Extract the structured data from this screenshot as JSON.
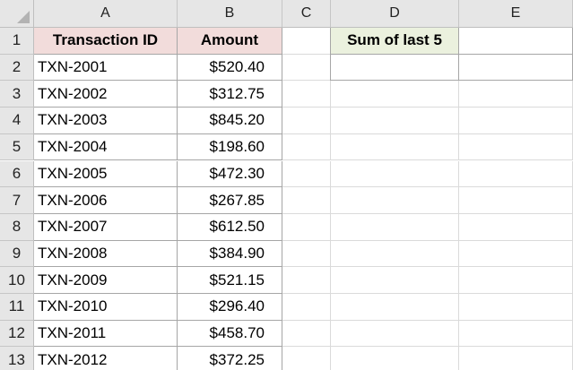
{
  "sheet": {
    "columns": [
      "A",
      "B",
      "C",
      "D",
      "E"
    ],
    "rows": [
      "1",
      "2",
      "3",
      "4",
      "5",
      "6",
      "7",
      "8",
      "9",
      "10",
      "11",
      "12",
      "13"
    ],
    "header": {
      "col_a": "Transaction ID",
      "col_b": "Amount",
      "col_d": "Sum of last 5",
      "col_e": ""
    },
    "records": [
      {
        "id": "TXN-2001",
        "amount": "$520.40"
      },
      {
        "id": "TXN-2002",
        "amount": "$312.75"
      },
      {
        "id": "TXN-2003",
        "amount": "$845.20"
      },
      {
        "id": "TXN-2004",
        "amount": "$198.60"
      },
      {
        "id": "TXN-2005",
        "amount": "$472.30"
      },
      {
        "id": "TXN-2006",
        "amount": "$267.85"
      },
      {
        "id": "TXN-2007",
        "amount": "$612.50"
      },
      {
        "id": "TXN-2008",
        "amount": "$384.90"
      },
      {
        "id": "TXN-2009",
        "amount": "$521.15"
      },
      {
        "id": "TXN-2010",
        "amount": "$296.40"
      },
      {
        "id": "TXN-2011",
        "amount": "$458.70"
      },
      {
        "id": "TXN-2012",
        "amount": "$372.25"
      }
    ],
    "colors": {
      "header_fill_ab": "#f2dcdb",
      "header_fill_d": "#ebf1de",
      "heading_bar": "#e6e6e6"
    }
  }
}
